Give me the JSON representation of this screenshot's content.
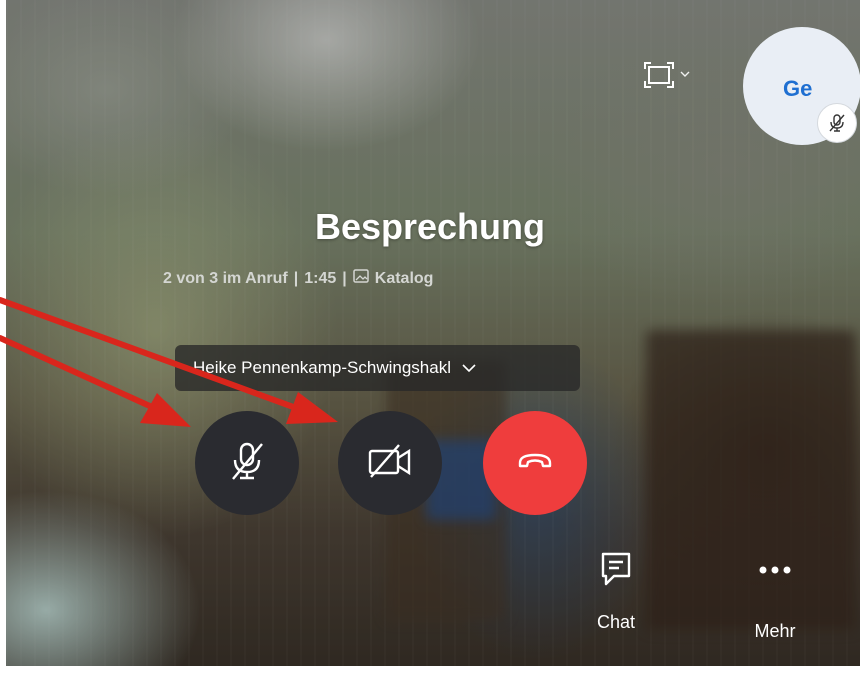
{
  "header": {
    "layout_icon": "screen-layout-icon",
    "avatar_initials": "Ge",
    "avatar_status_icon": "mic-off-icon"
  },
  "meeting": {
    "title": "Besprechung",
    "participants_status": "2 von 3 im Anruf",
    "duration": "1:45",
    "separator": "|",
    "catalog_icon": "picture-icon",
    "catalog_label": "Katalog"
  },
  "participant_selector": {
    "name": "Heike Pennenkamp-Schwingshakl",
    "chevron": "chevron-down-icon"
  },
  "controls": [
    {
      "name": "microphone",
      "state": "muted",
      "icon": "mic-off-icon"
    },
    {
      "name": "camera",
      "state": "off",
      "icon": "video-off-icon"
    },
    {
      "name": "hang-up",
      "icon": "phone-hangup-icon"
    }
  ],
  "bottom_actions": {
    "chat_label": "Chat",
    "more_label": "Mehr"
  },
  "colors": {
    "hangup_red": "#ef3d3d",
    "control_dark": "#2a2b30",
    "avatar_text": "#1f6fd1",
    "annotation_arrow": "#d9261c"
  },
  "annotations": {
    "arrow_count": 2,
    "targets": [
      "microphone",
      "camera"
    ]
  }
}
